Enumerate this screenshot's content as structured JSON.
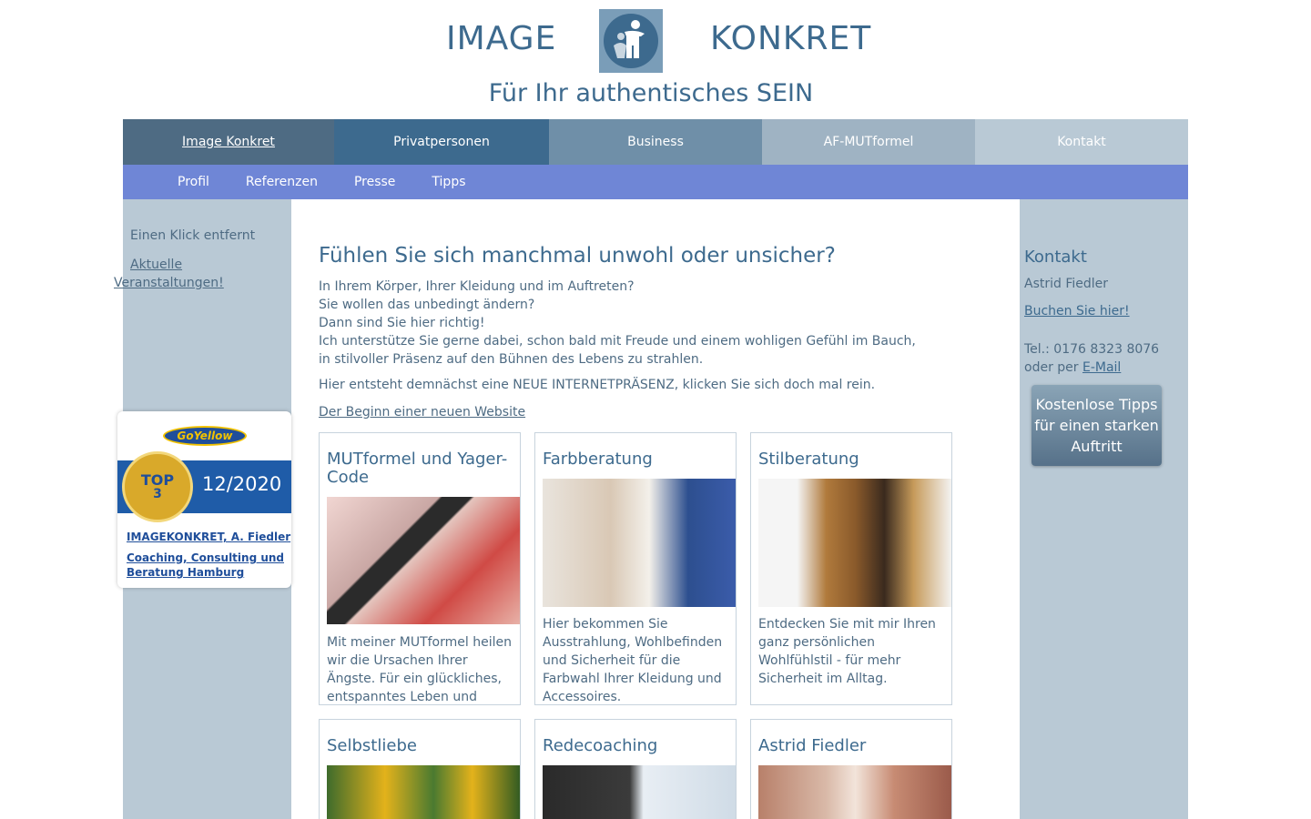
{
  "header": {
    "brand_left": "IMAGE",
    "brand_right": "KONKRET",
    "tagline": "Für Ihr authentisches SEIN"
  },
  "nav": {
    "items": [
      {
        "label": "Image Konkret",
        "color": "#4e6b83",
        "active": true
      },
      {
        "label": "Privatpersonen",
        "color": "#3d6a8e",
        "active": false
      },
      {
        "label": "Business",
        "color": "#6f8fa8",
        "active": false
      },
      {
        "label": "AF-MUTformel",
        "color": "#9fb3c3",
        "active": false
      },
      {
        "label": "Kontakt",
        "color": "#b9c9d5",
        "active": false
      }
    ],
    "sub_items": [
      "Profil",
      "Referenzen",
      "Presse",
      "Tipps"
    ]
  },
  "left": {
    "text": "Einen Klick entfernt",
    "link": "Aktuelle Veranstaltungen!"
  },
  "badge": {
    "logo": "GoYellow",
    "medal_top": "TOP",
    "medal_num": "3",
    "date": "12/2020",
    "link1": "IMAGEKONKRET, A. Fiedler",
    "link2": "Coaching, Consulting und Beratung Hamburg"
  },
  "main": {
    "headline": "Fühlen Sie sich manchmal unwohl oder unsicher?",
    "intro_lines": [
      "In Ihrem Körper, Ihrer Kleidung und im Auftreten?",
      "Sie wollen das unbedingt ändern?",
      "Dann sind Sie hier richtig!",
      "Ich unterstütze Sie gerne dabei, schon bald mit Freude und einem wohligen Gefühl im Bauch,",
      "in stilvoller Präsenz auf den Bühnen des Lebens zu strahlen."
    ],
    "intro2": "Hier entsteht demnächst eine NEUE INTERNETPRÄSENZ, klicken Sie sich doch mal rein.",
    "intro_link": "Der Beginn einer neuen Website",
    "cards": [
      {
        "title": "MUTformel und Yager-Code",
        "text": "Mit meiner MUTformel heilen wir die Ursachen Ihrer Ängste. Für ein glückliches, entspanntes Leben und"
      },
      {
        "title": "Farbberatung",
        "text": "Hier bekommen Sie Ausstrahlung, Wohlbefinden und Sicherheit für die Farbwahl Ihrer Kleidung und Accessoires."
      },
      {
        "title": "Stilberatung",
        "text": "Entdecken Sie mit mir Ihren ganz persönlichen Wohlfühlstil - für mehr Sicherheit im Alltag."
      },
      {
        "title": "Selbstliebe",
        "text": ""
      },
      {
        "title": "Redecoaching",
        "text": ""
      },
      {
        "title": "Astrid Fiedler",
        "text": ""
      }
    ]
  },
  "right": {
    "title": "Kontakt",
    "name": "Astrid Fiedler",
    "book": "Buchen Sie hier!",
    "tel": "Tel.: 0176 8323 8076",
    "email_prefix": "oder per",
    "email": "E-Mail",
    "button": "Kostenlose Tipps für einen starken Auftritt"
  }
}
